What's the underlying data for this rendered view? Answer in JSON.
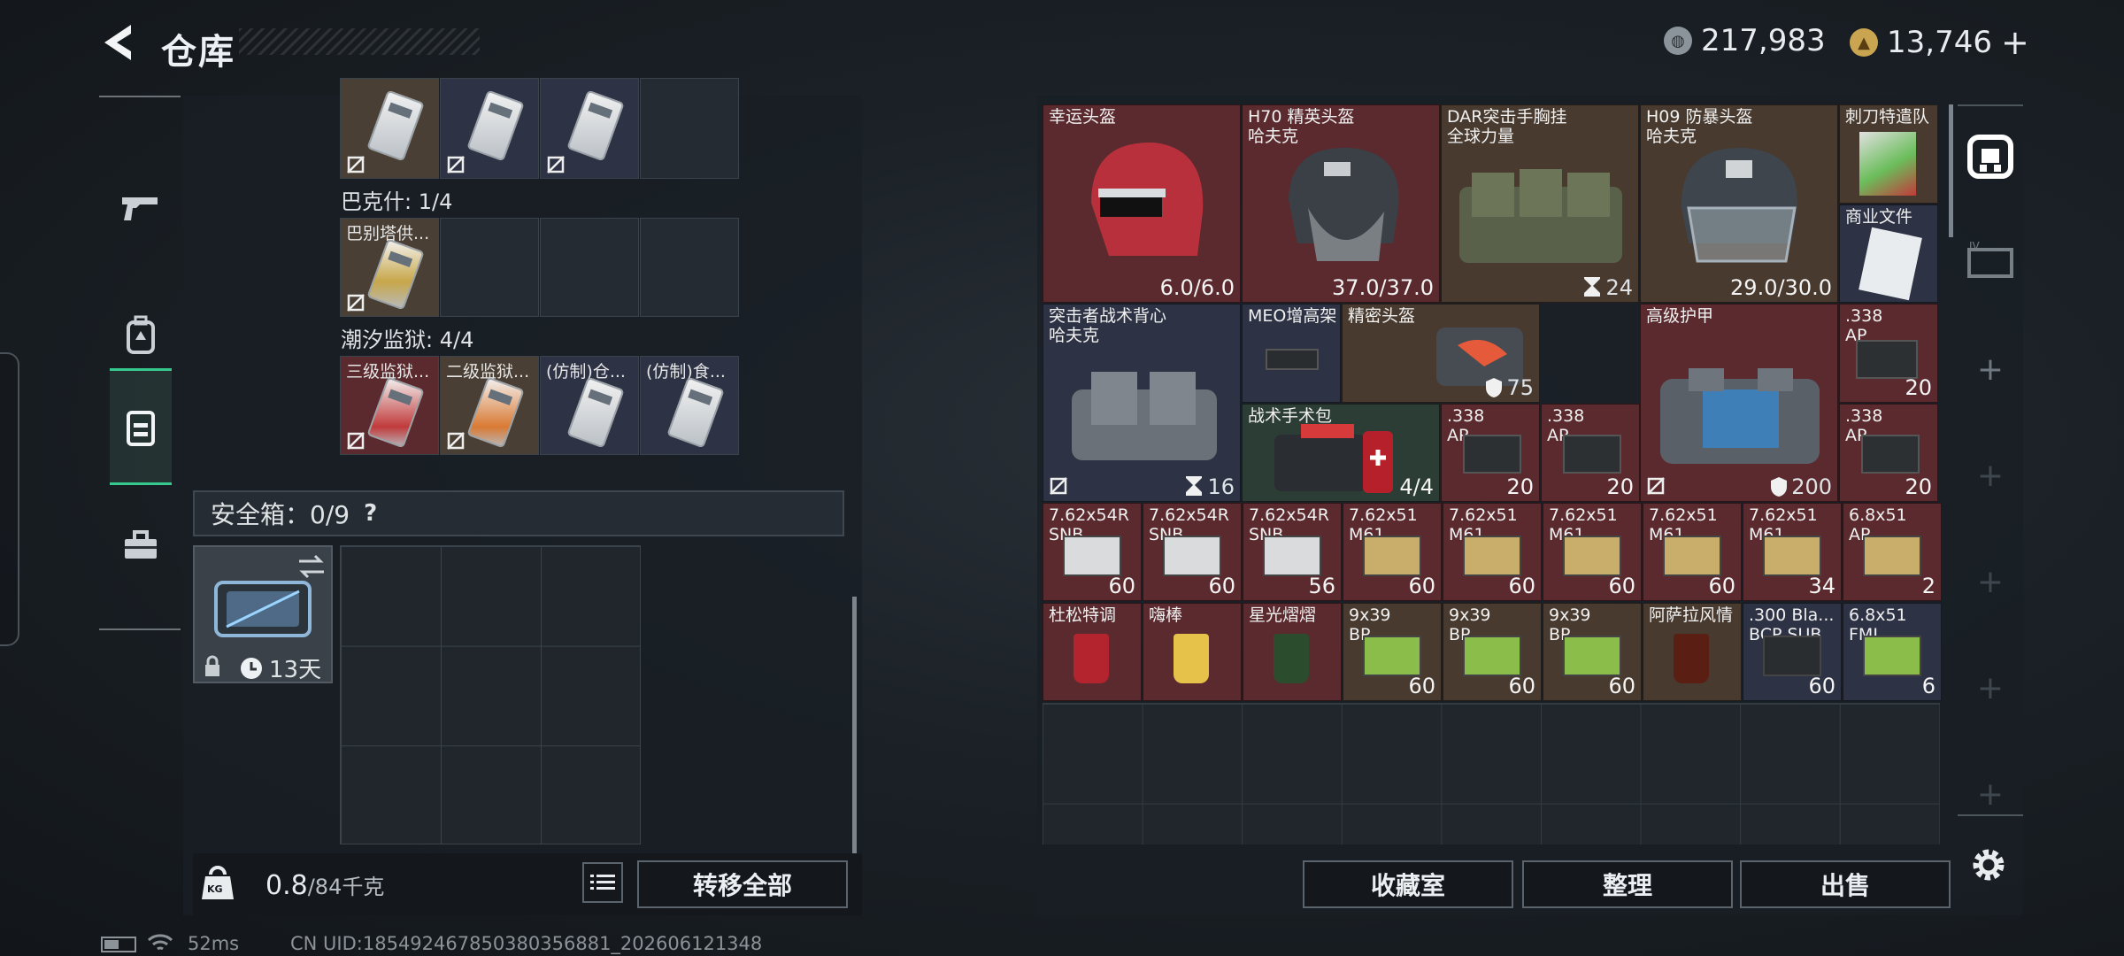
{
  "header": {
    "title": "仓库",
    "currency1_value": "217,983",
    "currency2_value": "13,746",
    "currency2_plus": "+"
  },
  "icons": {
    "back": "back-arrow-icon",
    "weapon": "weapon-icon",
    "backpack": "backpack-icon",
    "vest": "vest-icon",
    "toolbox": "toolbox-icon",
    "safe": "safe-icon",
    "settings": "gear-icon"
  },
  "left": {
    "groups": [
      {
        "label": "巴克什: 1/4",
        "item": "巴别塔供..."
      },
      {
        "label": "潮汐监狱: 4/4",
        "items": [
          "三级监狱...",
          "二级监狱...",
          "(仿制)仓...",
          "(仿制)食..."
        ]
      }
    ],
    "safebox_label": "安全箱：0/9",
    "safebox_help": "?",
    "safebox_timer": "13天",
    "weight_value": "0.8",
    "weight_unit": "/84千克",
    "weight_icon_text": "KG",
    "transfer_button": "转移全部"
  },
  "inventory": {
    "items": [
      {
        "id": "lucky-helmet",
        "label": "幸运头盔",
        "value": "6.0/6.0",
        "color": "#5b2a2e"
      },
      {
        "id": "h70",
        "label": "H70 精英头盔\n哈夫克",
        "value": "37.0/37.0",
        "color": "#5b2a2e"
      },
      {
        "id": "dar",
        "label": "DAR突击手胸挂\n全球力量",
        "value": "24",
        "color": "#483a2e"
      },
      {
        "id": "h09",
        "label": "H09 防暴头盔\n哈夫克",
        "value": "29.0/30.0",
        "color": "#483a2e"
      },
      {
        "id": "knife",
        "label": "刺刀特遣队",
        "value": "",
        "color": "#483a2e"
      },
      {
        "id": "docs",
        "label": "商业文件",
        "value": "",
        "color": "#2d3244"
      },
      {
        "id": "assault-vest",
        "label": "突击者战术背心\n哈夫克",
        "value": "16",
        "color": "#2d3244"
      },
      {
        "id": "meo",
        "label": "MEO增高架",
        "value": "",
        "color": "#2d3244"
      },
      {
        "id": "precise-helmet",
        "label": "精密头盔",
        "value": "75",
        "color": "#483a2e"
      },
      {
        "id": "armor",
        "label": "高级护甲",
        "value": "200",
        "color": "#5b2a2e"
      },
      {
        "id": "ap338-a",
        "label": ".338\nAP",
        "value": "20",
        "color": "#5b2a2e"
      },
      {
        "id": "medkit",
        "label": "战术手术包",
        "value": "4/4",
        "color": "#2c3d36"
      },
      {
        "id": "ap338-b",
        "label": ".338\nAP",
        "value": "20",
        "color": "#5b2a2e"
      },
      {
        "id": "ap338-c",
        "label": ".338\nAP",
        "value": "20",
        "color": "#5b2a2e"
      },
      {
        "id": "ap338-d",
        "label": ".338\nAP",
        "value": "20",
        "color": "#5b2a2e"
      }
    ],
    "ammo_row": [
      {
        "label": "7.62x54R\nSNB",
        "value": "60"
      },
      {
        "label": "7.62x54R\nSNB",
        "value": "60"
      },
      {
        "label": "7.62x54R\nSNB",
        "value": "56"
      },
      {
        "label": "7.62x51\nM61",
        "value": "60"
      },
      {
        "label": "7.62x51\nM61",
        "value": "60"
      },
      {
        "label": "7.62x51\nM61",
        "value": "60"
      },
      {
        "label": "7.62x51\nM61",
        "value": "60"
      },
      {
        "label": "7.62x51\nM61",
        "value": "34"
      },
      {
        "label": "6.8x51\nAP",
        "value": "2"
      }
    ],
    "consumable_row": [
      {
        "label": "杜松特调",
        "value": ""
      },
      {
        "label": "嗨棒",
        "value": ""
      },
      {
        "label": "星光熠熠",
        "value": ""
      },
      {
        "label": "9x39\nBP",
        "value": "60"
      },
      {
        "label": "9x39\nBP",
        "value": "60"
      },
      {
        "label": "9x39\nBP",
        "value": "60"
      },
      {
        "label": "阿萨拉风情",
        "value": ""
      },
      {
        "label": ".300 Bla...\nBCP SUB",
        "value": "60"
      },
      {
        "label": "6.8x51\nFMJ",
        "value": "6"
      }
    ],
    "buttons": [
      "收藏室",
      "整理",
      "出售"
    ]
  },
  "status": {
    "ping": "52ms",
    "uid": "CN UID:185492467850380356881_202606121348"
  },
  "side": {
    "plus": "+"
  }
}
